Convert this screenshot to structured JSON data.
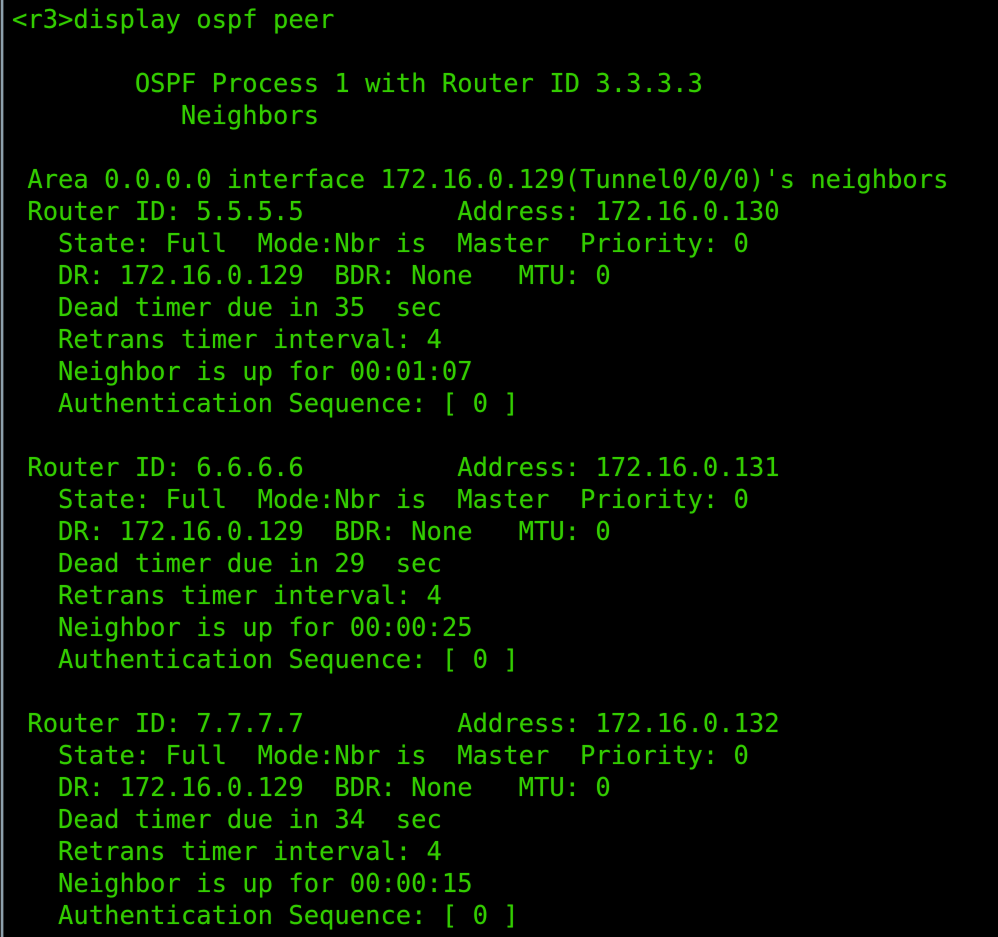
{
  "terminal": {
    "background_color": "#000000",
    "text_color": "#33cc00",
    "scrollbar_color": "#8da0ac",
    "prompt": "<r3>",
    "command": "display ospf peer",
    "command_line": "<r3>display ospf peer",
    "header": {
      "process_line": "        OSPF Process 1 with Router ID 3.3.3.3",
      "process_id": "1",
      "router_id": "3.3.3.3",
      "neighbors_label": "           Neighbors"
    },
    "area": {
      "line": " Area 0.0.0.0 interface 172.16.0.129(Tunnel0/0/0)'s neighbors",
      "area_id": "0.0.0.0",
      "interface_ip": "172.16.0.129",
      "interface_name": "Tunnel0/0/0"
    },
    "neighbors": [
      {
        "router_id_line": " Router ID: 5.5.5.5          Address: 172.16.0.130",
        "state_line": "   State: Full  Mode:Nbr is  Master  Priority: 0",
        "dr_line": "   DR: 172.16.0.129  BDR: None   MTU: 0",
        "dead_timer_line": "   Dead timer due in 35  sec",
        "retrans_line": "   Retrans timer interval: 4",
        "uptime_line": "   Neighbor is up for 00:01:07",
        "auth_line": "   Authentication Sequence: [ 0 ]",
        "router_id": "5.5.5.5",
        "address": "172.16.0.130",
        "state": "Full",
        "mode": "Nbr is  Master",
        "priority": "0",
        "dr": "172.16.0.129",
        "bdr": "None",
        "mtu": "0",
        "dead_timer": "35",
        "retrans_interval": "4",
        "uptime": "00:01:07",
        "auth_sequence": "[ 0 ]"
      },
      {
        "router_id_line": " Router ID: 6.6.6.6          Address: 172.16.0.131",
        "state_line": "   State: Full  Mode:Nbr is  Master  Priority: 0",
        "dr_line": "   DR: 172.16.0.129  BDR: None   MTU: 0",
        "dead_timer_line": "   Dead timer due in 29  sec",
        "retrans_line": "   Retrans timer interval: 4",
        "uptime_line": "   Neighbor is up for 00:00:25",
        "auth_line": "   Authentication Sequence: [ 0 ]",
        "router_id": "6.6.6.6",
        "address": "172.16.0.131",
        "state": "Full",
        "mode": "Nbr is  Master",
        "priority": "0",
        "dr": "172.16.0.129",
        "bdr": "None",
        "mtu": "0",
        "dead_timer": "29",
        "retrans_interval": "4",
        "uptime": "00:00:25",
        "auth_sequence": "[ 0 ]"
      },
      {
        "router_id_line": " Router ID: 7.7.7.7          Address: 172.16.0.132",
        "state_line": "   State: Full  Mode:Nbr is  Master  Priority: 0",
        "dr_line": "   DR: 172.16.0.129  BDR: None   MTU: 0",
        "dead_timer_line": "   Dead timer due in 34  sec",
        "retrans_line": "   Retrans timer interval: 4",
        "uptime_line": "   Neighbor is up for 00:00:15",
        "auth_line": "   Authentication Sequence: [ 0 ]",
        "router_id": "7.7.7.7",
        "address": "172.16.0.132",
        "state": "Full",
        "mode": "Nbr is  Master",
        "priority": "0",
        "dr": "172.16.0.129",
        "bdr": "None",
        "mtu": "0",
        "dead_timer": "34",
        "retrans_interval": "4",
        "uptime": "00:00:15",
        "auth_sequence": "[ 0 ]"
      }
    ],
    "blank": ""
  }
}
